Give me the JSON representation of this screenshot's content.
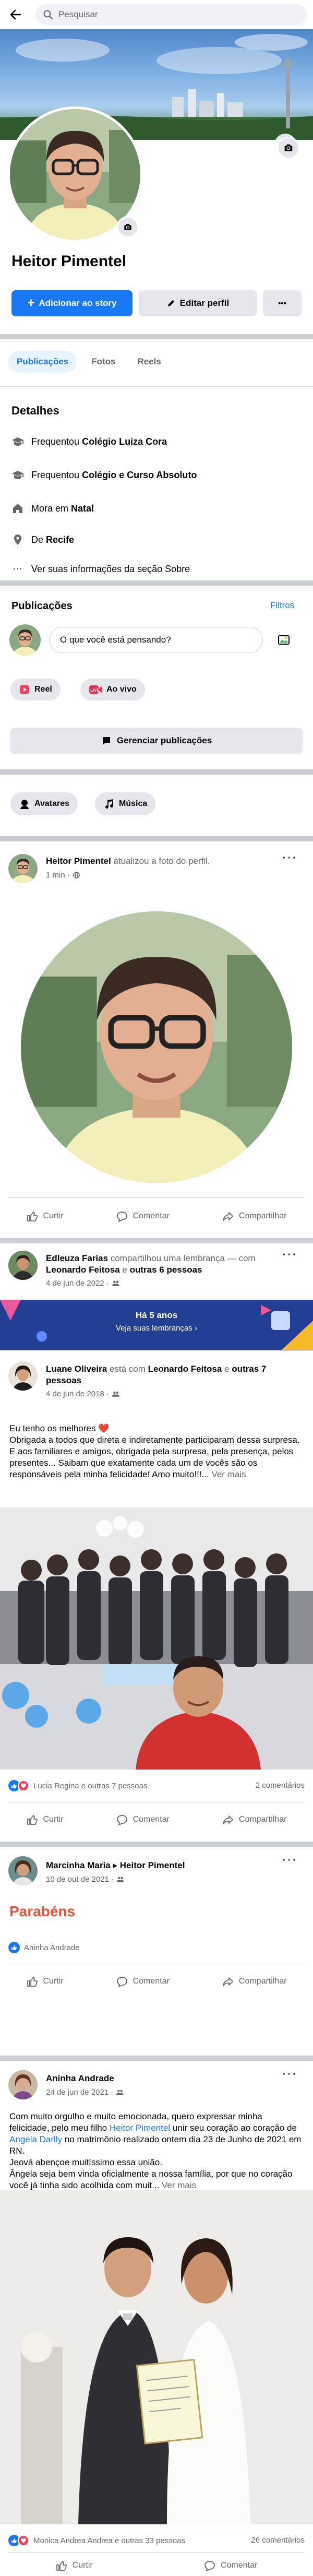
{
  "search": {
    "placeholder": "Pesquisar"
  },
  "profile": {
    "name": "Heitor Pimentel",
    "add_story_label": "Adicionar ao story",
    "edit_profile_label": "Editar perfil",
    "more_label": "•••"
  },
  "tabs": [
    "Publicações",
    "Fotos",
    "Reels"
  ],
  "details": {
    "title": "Detalhes",
    "items": [
      {
        "prefix": "Frequentou ",
        "strong": "Colégio Luiza Cora"
      },
      {
        "prefix": "Frequentou ",
        "strong": "Colégio e Curso Absoluto"
      },
      {
        "prefix": "Mora em ",
        "strong": "Natal"
      },
      {
        "prefix": "De ",
        "strong": "Recife"
      }
    ],
    "see_more": "Ver suas informações da seção Sobre"
  },
  "publications": {
    "title": "Publicações",
    "filters_label": "Filtros",
    "composer_placeholder": "O que você está pensando?",
    "reel_label": "Reel",
    "live_label": "Ao vivo",
    "manage_label": "Gerenciar publicações",
    "avatars_label": "Avatares",
    "music_label": "Música"
  },
  "actions": {
    "like": "Curtir",
    "comment": "Comentar",
    "share": "Compartilhar"
  },
  "post1": {
    "author": "Heitor Pimentel",
    "action": " atualizou a foto do perfil.",
    "time": "1 min ·"
  },
  "post2": {
    "author": "Edleuza Farias",
    "action": " compartilhou uma lembrança — com ",
    "with": "Leonardo Feitosa",
    "and": " e ",
    "others": "outras 6 pessoas",
    "time": "4 de jun de 2022 ·",
    "memory_title": "Há 5 anos",
    "memory_sub": "Veja suas lembranças ›"
  },
  "post2_inner": {
    "author": "Luane Oliveira",
    "action": " está com ",
    "with": "Leonardo Feitosa",
    "and": " e ",
    "others": "outras 7 pessoas",
    "time": "4 de jun de 2018 ·",
    "text": "Eu tenho os melhores ❤️\nObrigada a todos que direta e indiretamente participaram dessa surpresa. E aos familiares e amigos, obrigada pela surpresa, pela presença, pelos presentes... Saibam que exatamente cada um de vocês são os responsáveis pela minha  felicidade! Amo muito!!!... ",
    "see_more": "Ver mais",
    "reactions": "Lucia Regina e outras 7 pessoas",
    "comments": "2 comentários"
  },
  "post3": {
    "author": "Marcinha Maria",
    "arrow": " ▸ ",
    "target": "Heitor Pimentel",
    "time": "10 de out de 2021 ·",
    "text": "Parabéns",
    "reactions": "Aninha Andrade"
  },
  "post4": {
    "author": "Aninha Andrade",
    "time": "24 de jun de 2021 ·",
    "text_a": "Com muito orgulho e muito emocionada, quero expressar minha felicidade, pelo meu filho ",
    "mention1": "Heitor Pimentel",
    "text_b": " unir seu coração ao coração de ",
    "mention2": "Angela Darlly",
    "text_c": " no matrimônio realizado ontem dia 23 de Junho de 2021 em RN.\nJeová abençoe muitíssimo essa união.\nÂngela seja bem vinda oficialmente a nossa família, por que no coração você já tinha sido acolhida com muit... ",
    "see_more": "Ver mais",
    "reactions": "Monica Andrea Andrea e outras 33 pessoas",
    "comments": "26 comentários"
  },
  "colors": {
    "accent": "#1877f2",
    "bg_sep": "#c9ccd1",
    "love": "#f33e58"
  }
}
